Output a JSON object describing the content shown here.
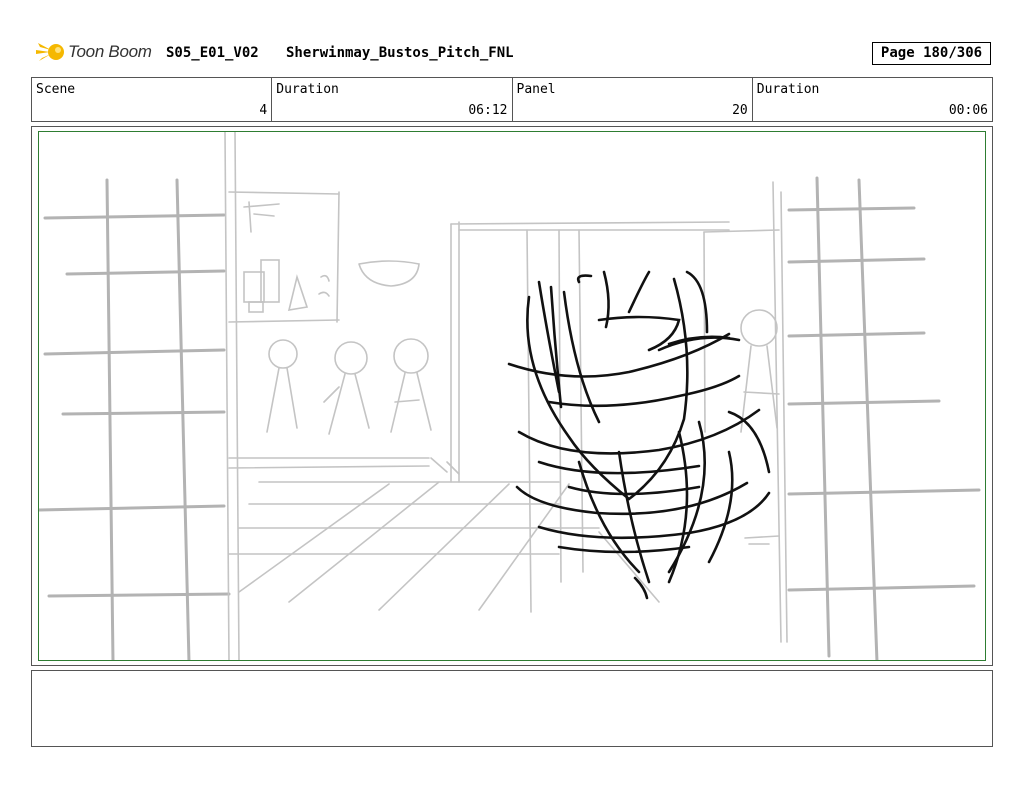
{
  "header": {
    "logo_text": "Toon Boom",
    "project_code": "S05_E01_V02",
    "project_name": "Sherwinmay_Bustos_Pitch_FNL",
    "page": "Page 180/306"
  },
  "info": {
    "scene_label": "Scene",
    "scene_value": "4",
    "scene_duration_label": "Duration",
    "scene_duration_value": "06:12",
    "panel_label": "Panel",
    "panel_value": "20",
    "panel_duration_label": "Duration",
    "panel_duration_value": "00:06"
  },
  "colors": {
    "logo_accent": "#f5b800",
    "panel_border": "#2e7d32",
    "sketch_gray": "#b0b0b0",
    "sketch_black": "#111111"
  },
  "icons": {
    "logo": "toon-boom-logo-icon"
  },
  "notes": ""
}
